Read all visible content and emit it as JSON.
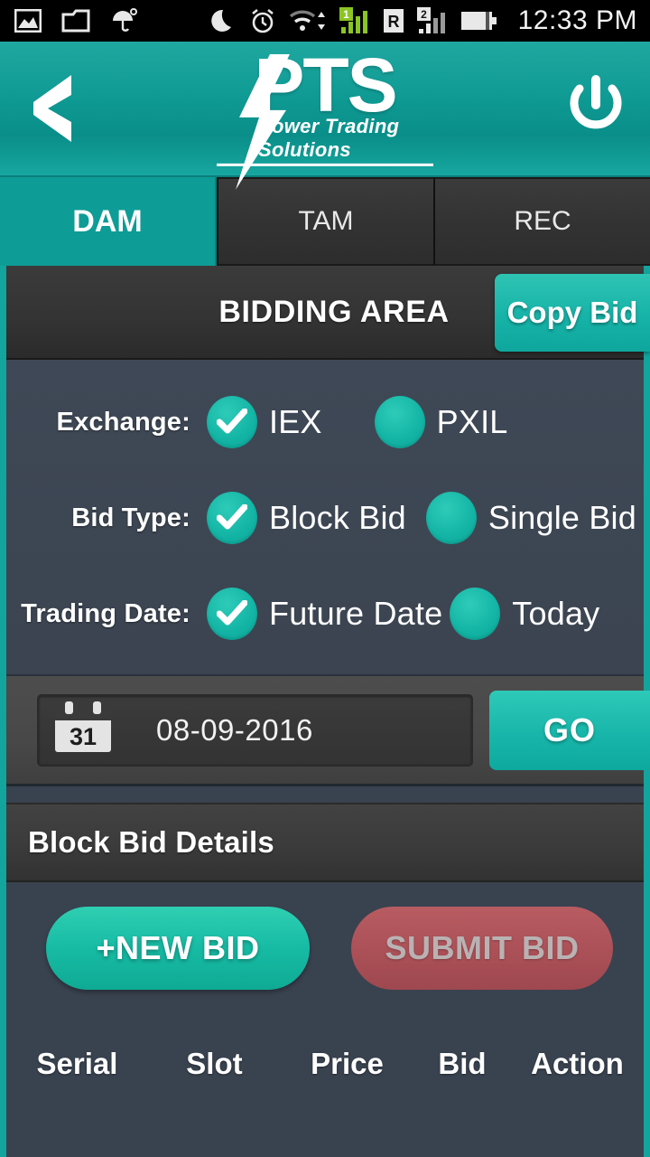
{
  "status_bar": {
    "icons_left": [
      "image-icon",
      "folder-icon",
      "umbrella-icon"
    ],
    "icons_right": [
      "moon-icon",
      "alarm-icon",
      "wifi-icon",
      "signal-sim1-icon",
      "roaming-icon",
      "signal-sim2-icon",
      "battery-icon"
    ],
    "sim1_label": "1",
    "sim2_label": "2",
    "roaming_label": "R",
    "time": "12:33 PM"
  },
  "header": {
    "back_icon": "back-chevron-icon",
    "logo_text": "PTS",
    "logo_tagline": "Power Trading Solutions",
    "bolt_icon": "lightning-bolt-icon",
    "power_icon": "power-icon",
    "accent_color": "#0e9c96"
  },
  "tabs": [
    {
      "label": "DAM",
      "active": true
    },
    {
      "label": "TAM",
      "active": false
    },
    {
      "label": "REC",
      "active": false
    }
  ],
  "bidding_area": {
    "title": "BIDDING AREA",
    "copy_bid_label": "Copy Bid"
  },
  "options": [
    {
      "label": "Exchange:",
      "choices": [
        {
          "text": "IEX",
          "selected": true
        },
        {
          "text": "PXIL",
          "selected": false
        }
      ]
    },
    {
      "label": "Bid Type:",
      "choices": [
        {
          "text": "Block Bid",
          "selected": true
        },
        {
          "text": "Single Bid",
          "selected": false
        }
      ]
    },
    {
      "label": "Trading Date:",
      "choices": [
        {
          "text": "Future Date",
          "selected": true
        },
        {
          "text": "Today",
          "selected": false
        }
      ]
    }
  ],
  "date_row": {
    "calendar_icon": "calendar-icon",
    "calendar_day": "31",
    "date_value": "08-09-2016",
    "go_label": "GO"
  },
  "details_section": {
    "title": "Block Bid Details",
    "new_bid_label": "+NEW BID",
    "submit_bid_label": "SUBMIT BID",
    "submit_enabled": false
  },
  "table": {
    "columns": [
      "Serial",
      "Slot",
      "Price",
      "Bid",
      "Action"
    ],
    "rows": []
  },
  "colors": {
    "teal": "#0e9c96",
    "teal_light": "#18b6aa",
    "panel_blue": "#3f4856",
    "panel_dark": "#343434",
    "submit_red": "#ab5057"
  }
}
